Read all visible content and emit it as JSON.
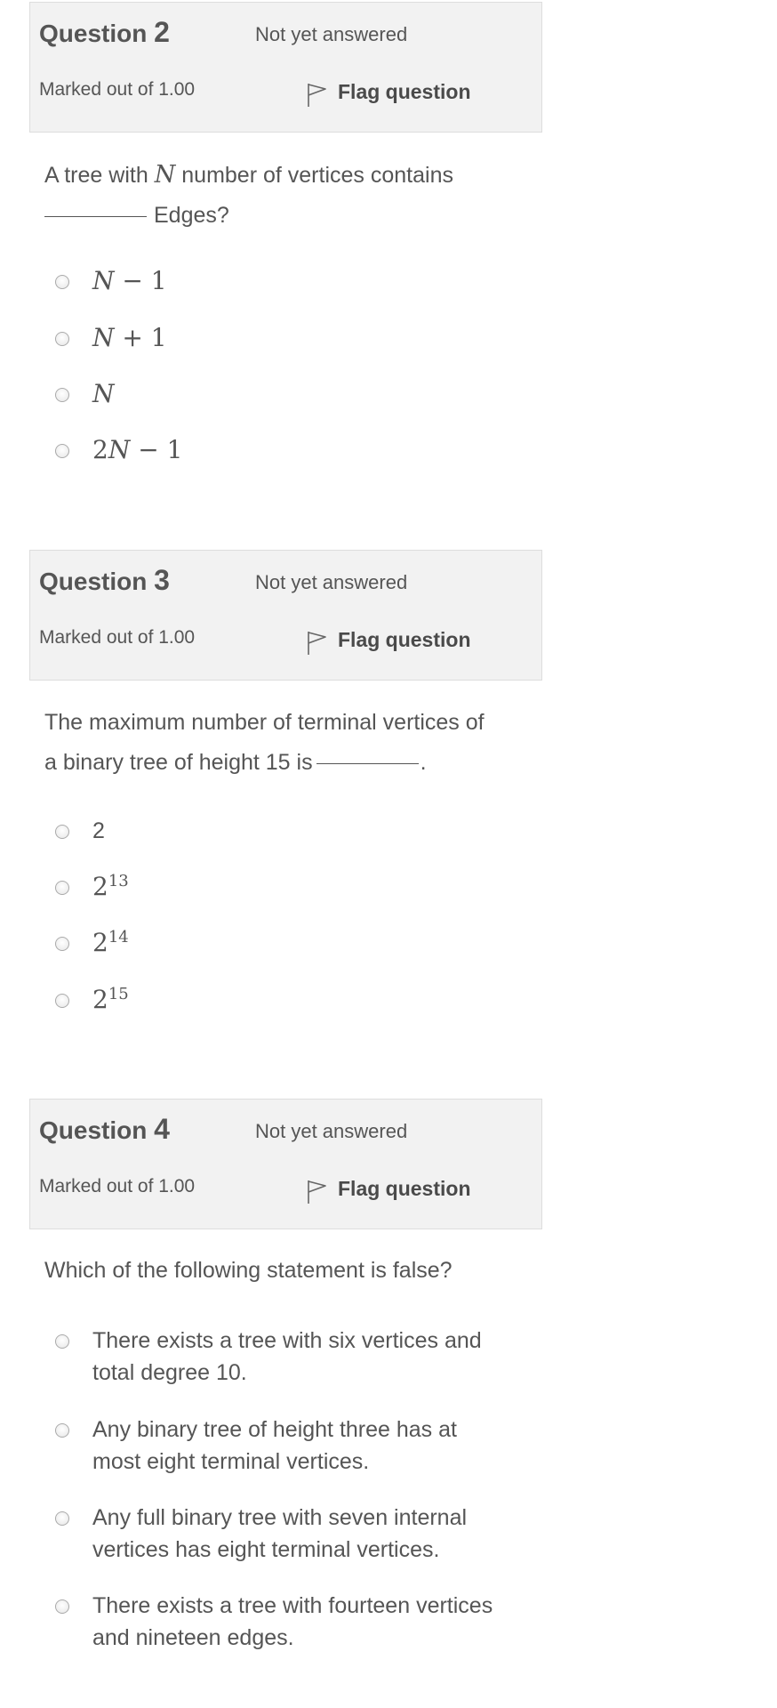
{
  "questions": [
    {
      "number_label": "Question",
      "number": "2",
      "state": "Not yet answered",
      "grade": "Marked out of 1.00",
      "flag_label": "Flag question",
      "text_a": "A tree with",
      "text_math": "N",
      "text_b": "number of vertices contains",
      "text_c": "Edges?",
      "options": [
        {
          "base": "N",
          "rest": " − 1"
        },
        {
          "base": "N",
          "rest": " + 1"
        },
        {
          "base": "N",
          "rest": ""
        },
        {
          "pre": "2",
          "base": "N",
          "rest": " − 1"
        }
      ]
    },
    {
      "number_label": "Question",
      "number": "3",
      "state": "Not yet answered",
      "grade": "Marked out of 1.00",
      "flag_label": "Flag question",
      "text_a": "The maximum number of terminal vertices of",
      "text_b": "a binary tree of height 15 is",
      "text_c": ".",
      "options": [
        {
          "base": "2",
          "exp": ""
        },
        {
          "base": "2",
          "exp": "13"
        },
        {
          "base": "2",
          "exp": "14"
        },
        {
          "base": "2",
          "exp": "15"
        }
      ]
    },
    {
      "number_label": "Question",
      "number": "4",
      "state": "Not yet answered",
      "grade": "Marked out of 1.00",
      "flag_label": "Flag question",
      "text": "Which of the following statement is false?",
      "options": [
        {
          "line1": "There exists a tree with six vertices and",
          "line2": "total degree 10."
        },
        {
          "line1": "Any binary tree of height three has at",
          "line2": "most eight terminal vertices."
        },
        {
          "line1": "Any full binary tree with seven internal",
          "line2": "vertices has eight terminal vertices."
        },
        {
          "line1": "There exists a tree with fourteen vertices",
          "line2": "and nineteen edges."
        }
      ]
    }
  ]
}
